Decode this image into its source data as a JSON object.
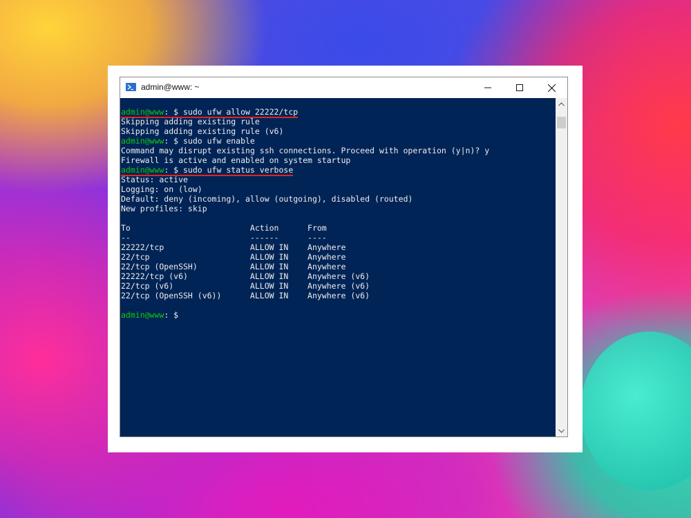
{
  "window": {
    "title": "admin@www: ~",
    "icon": "powershell-icon",
    "buttons": [
      "minimize-icon",
      "maximize-icon",
      "close-icon"
    ]
  },
  "colors": {
    "terminal_bg": "#012456",
    "prompt_user": "#16c60c",
    "text": "#eeeeee",
    "highlight_underline": "#e0241f"
  },
  "terminal": {
    "lines": [
      {
        "user": "admin@www",
        "rest": ": $ sudo ufw allow 22222/tcp",
        "highlight": true
      },
      {
        "text": "Skipping adding existing rule"
      },
      {
        "text": "Skipping adding existing rule (v6)"
      },
      {
        "user": "admin@www",
        "rest": ": $ sudo ufw enable"
      },
      {
        "text": "Command may disrupt existing ssh connections. Proceed with operation (y|n)? y"
      },
      {
        "text": "Firewall is active and enabled on system startup"
      },
      {
        "user": "admin@www",
        "rest": ": $ sudo ufw status verbose",
        "highlight": true
      },
      {
        "text": "Status: active"
      },
      {
        "text": "Logging: on (low)"
      },
      {
        "text": "Default: deny (incoming), allow (outgoing), disabled (routed)"
      },
      {
        "text": "New profiles: skip"
      },
      {
        "text": ""
      },
      {
        "text": "To                         Action      From"
      },
      {
        "text": "--                         ------      ----"
      },
      {
        "text": "22222/tcp                  ALLOW IN    Anywhere"
      },
      {
        "text": "22/tcp                     ALLOW IN    Anywhere"
      },
      {
        "text": "22/tcp (OpenSSH)           ALLOW IN    Anywhere"
      },
      {
        "text": "22222/tcp (v6)             ALLOW IN    Anywhere (v6)"
      },
      {
        "text": "22/tcp (v6)                ALLOW IN    Anywhere (v6)"
      },
      {
        "text": "22/tcp (OpenSSH (v6))      ALLOW IN    Anywhere (v6)"
      },
      {
        "text": ""
      },
      {
        "user": "admin@www",
        "rest": ": $"
      }
    ]
  }
}
